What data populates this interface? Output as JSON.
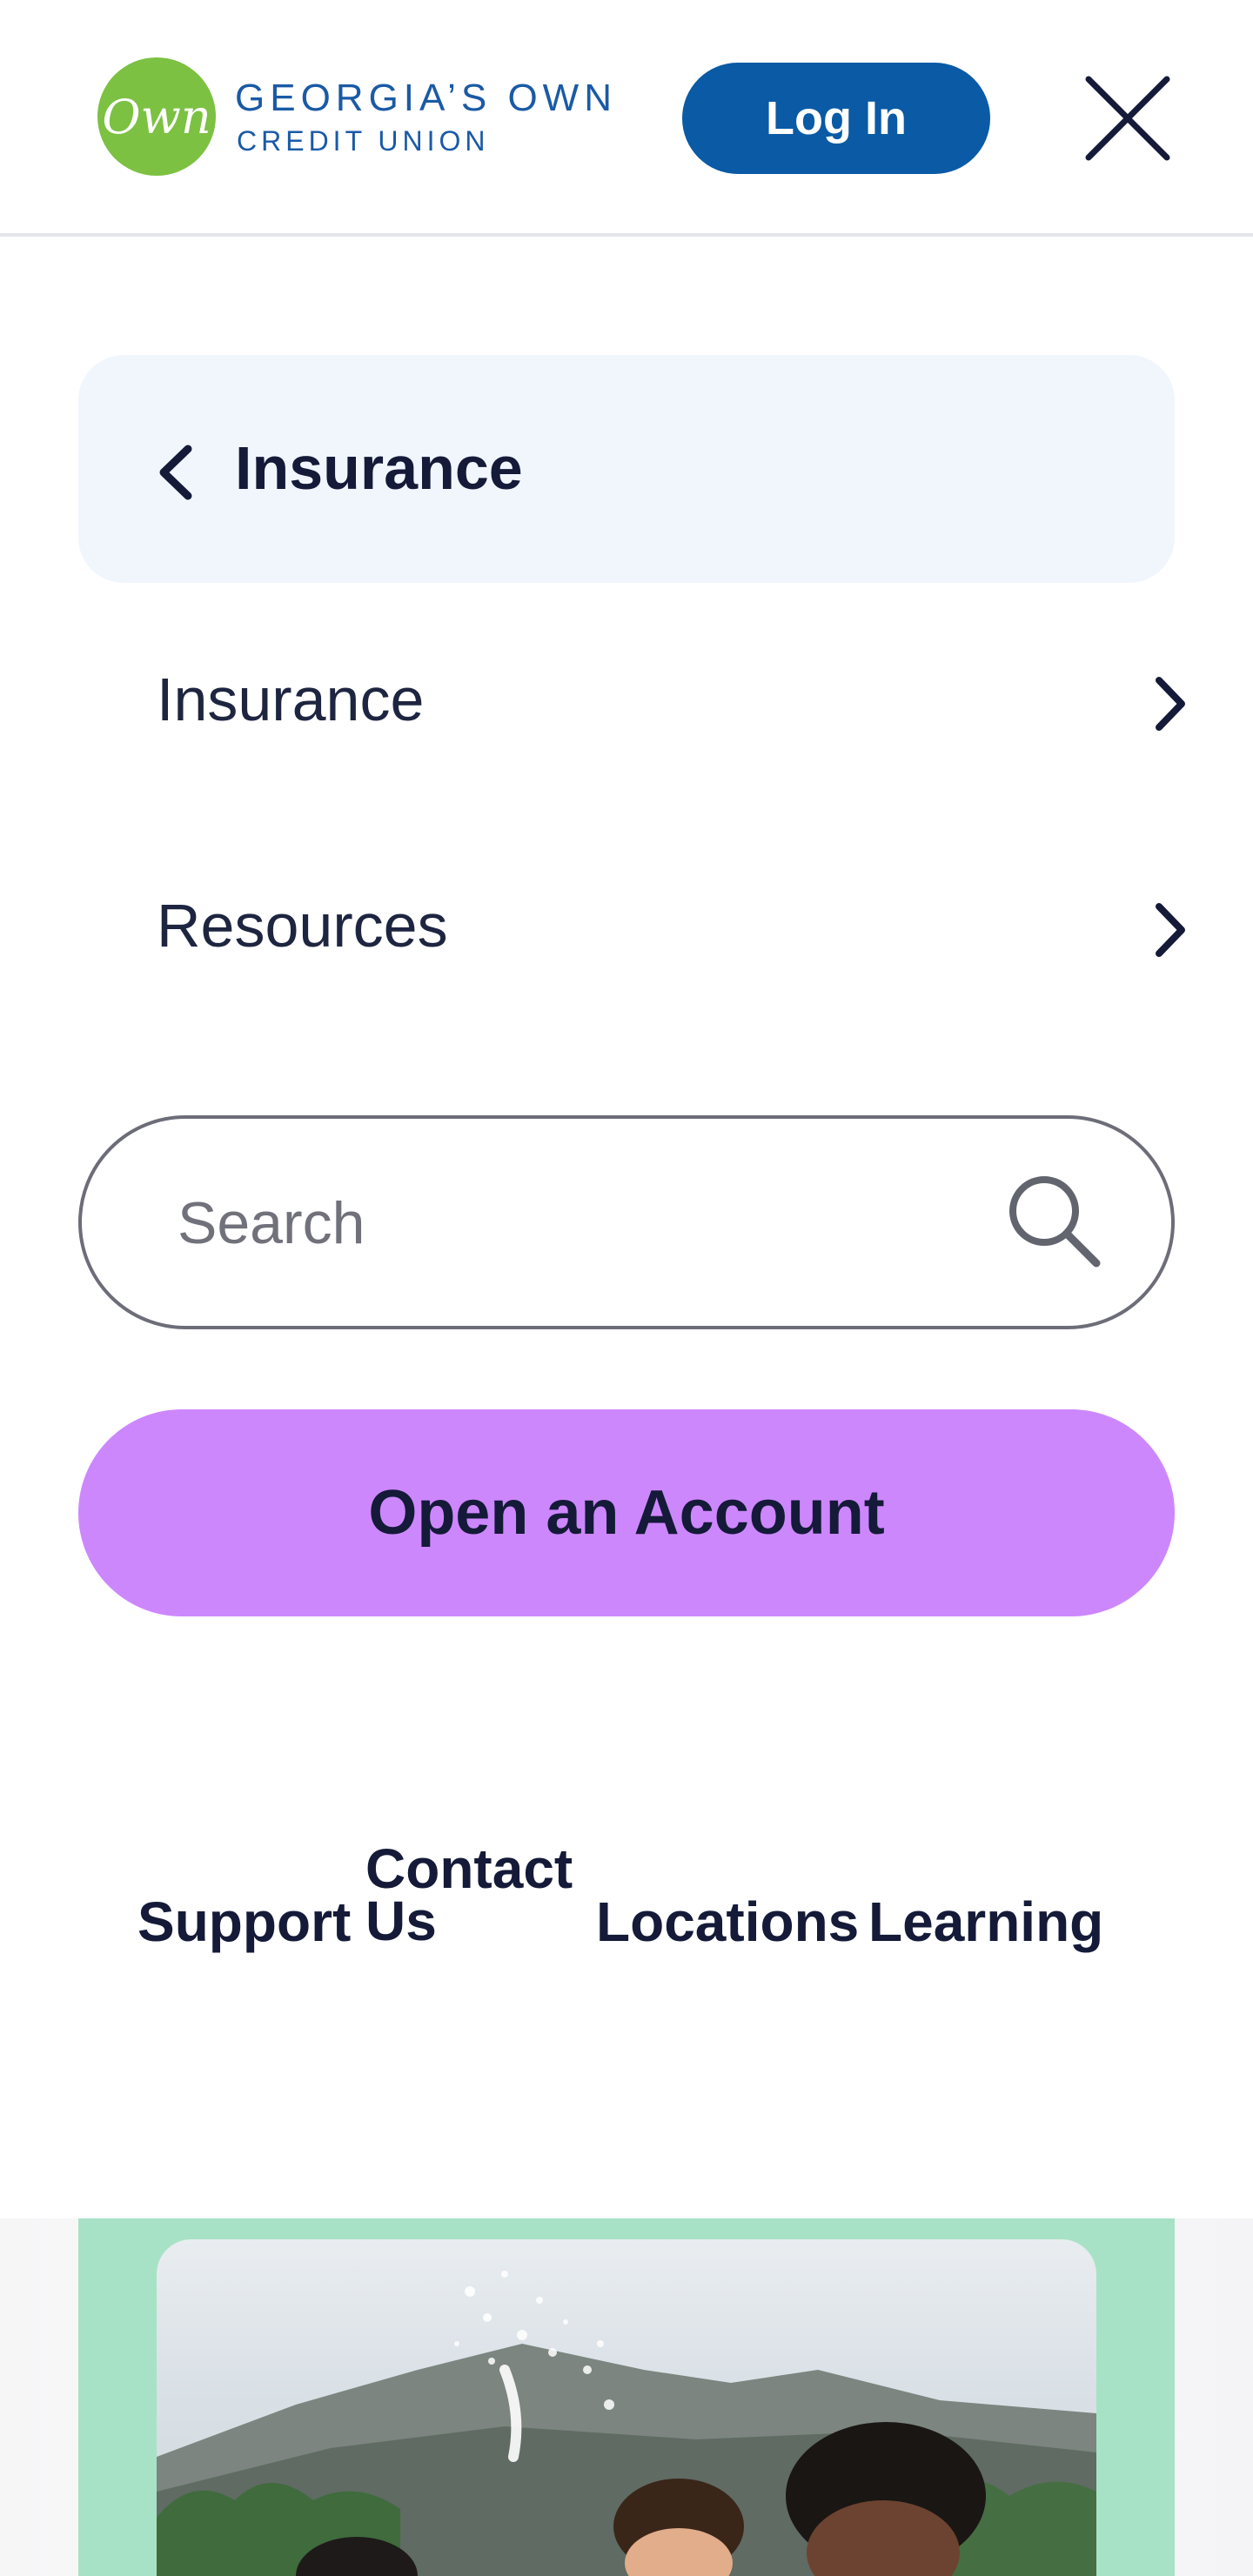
{
  "header": {
    "logo_mark": "Own",
    "logo_line1": "GEORGIA’S OWN",
    "logo_line2": "CREDIT UNION",
    "login_label": "Log In",
    "brand_color": "#0a5aa5",
    "logo_color": "#7cc142"
  },
  "menu": {
    "back_label": "Insurance",
    "items": [
      {
        "label": "Insurance"
      },
      {
        "label": "Resources"
      }
    ]
  },
  "search": {
    "placeholder": "Search",
    "value": ""
  },
  "cta": {
    "label": "Open an Account",
    "color": "#cd87fd"
  },
  "utility_links": {
    "support": "Support",
    "contact_line1": "Contact",
    "contact_line2": "Us",
    "locations": "Locations",
    "learning": "Learning"
  },
  "promo": {
    "card_color": "#a8e2c6"
  },
  "icons": {
    "close": "close-icon",
    "back": "chevron-left-icon",
    "item": "chevron-right-icon",
    "search": "search-icon"
  }
}
